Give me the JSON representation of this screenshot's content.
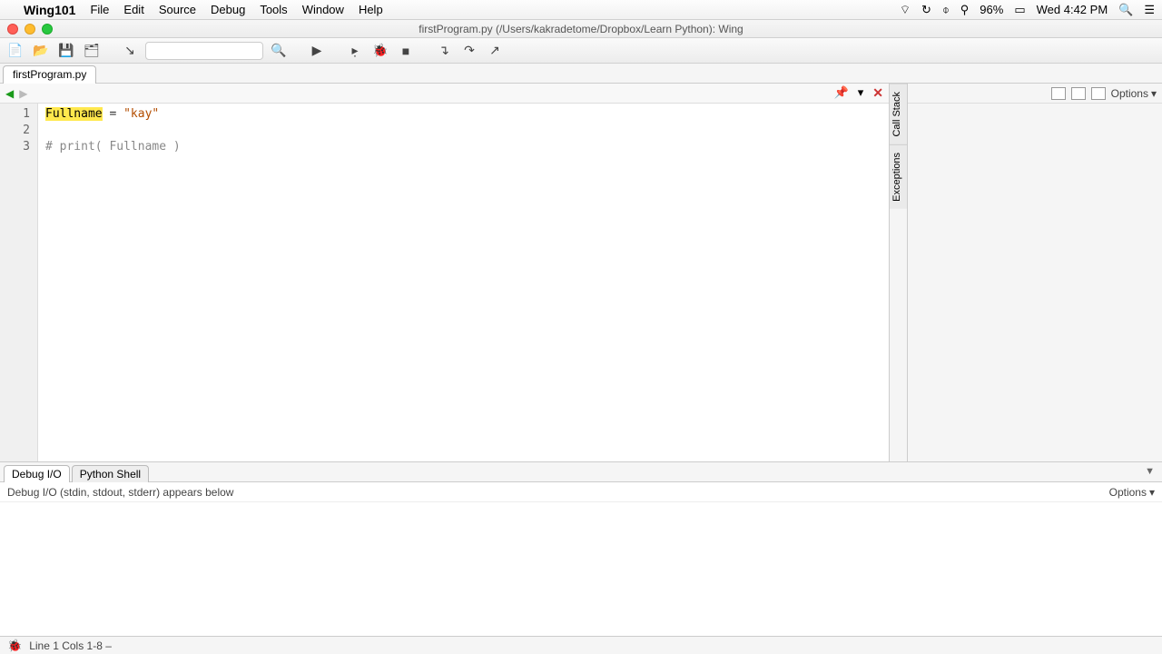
{
  "menubar": {
    "app": "Wing101",
    "items": [
      "File",
      "Edit",
      "Source",
      "Debug",
      "Tools",
      "Window",
      "Help"
    ],
    "battery": "96%",
    "datetime": "Wed 4:42 PM"
  },
  "window": {
    "title": "firstProgram.py (/Users/kakradetome/Dropbox/Learn Python): Wing"
  },
  "tabs": {
    "file_tab": "firstProgram.py"
  },
  "code": {
    "line_numbers": [
      "1",
      "2",
      "3"
    ],
    "line1": {
      "var": "Fullname",
      "rest": " = ",
      "str": "\"kay\""
    },
    "line3": "# print( Fullname )"
  },
  "side": {
    "tab1": "Call Stack",
    "tab2": "Exceptions",
    "options": "Options"
  },
  "bottom": {
    "tab1": "Debug I/O",
    "tab2": "Python Shell",
    "header": "Debug I/O (stdin, stdout, stderr) appears below",
    "options": "Options"
  },
  "status": {
    "text": "Line 1 Cols 1-8 –"
  }
}
